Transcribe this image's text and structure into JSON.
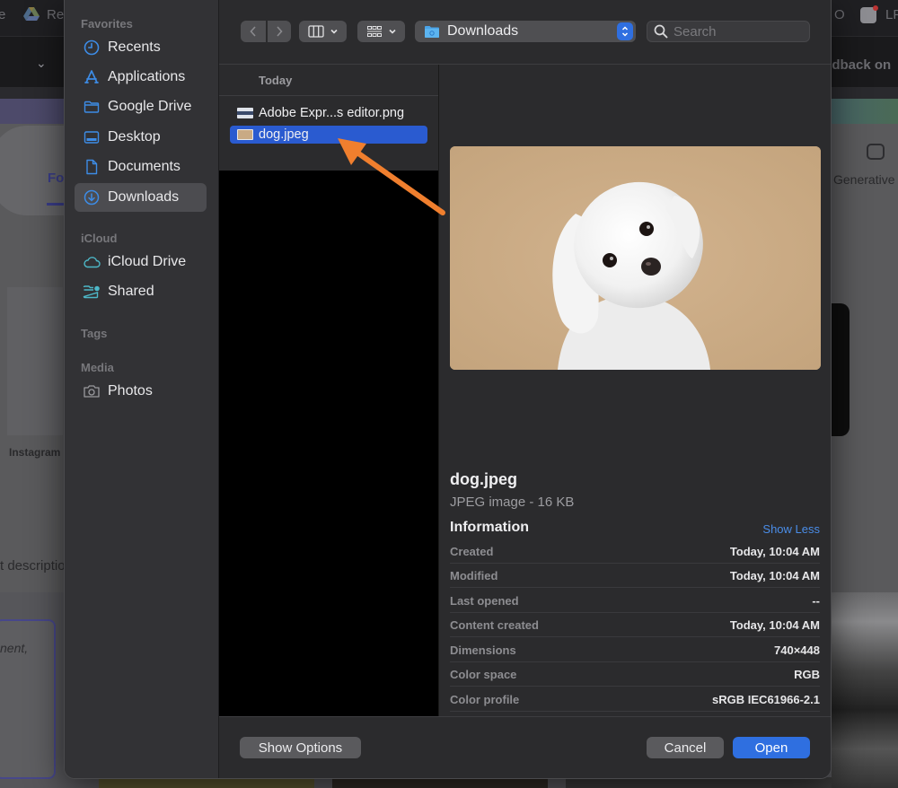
{
  "background_app": {
    "tabs": [
      "e",
      "Re",
      "O",
      "LF"
    ],
    "toolbar_text": "edback on",
    "tab_label_partial": "Fo",
    "template_label": "Instagram",
    "prompt_label_partial": "t description",
    "prompt_placeholder_partial": "nent,",
    "feature_label": "Generative"
  },
  "dialog": {
    "sidebar": {
      "sections": [
        {
          "title": "Favorites",
          "items": [
            {
              "label": "Recents",
              "icon": "clock-icon"
            },
            {
              "label": "Applications",
              "icon": "applications-icon"
            },
            {
              "label": "Google Drive",
              "icon": "folder-icon"
            },
            {
              "label": "Desktop",
              "icon": "desktop-icon"
            },
            {
              "label": "Documents",
              "icon": "document-icon"
            },
            {
              "label": "Downloads",
              "icon": "download-icon",
              "active": true
            }
          ]
        },
        {
          "title": "iCloud",
          "items": [
            {
              "label": "iCloud Drive",
              "icon": "cloud-icon"
            },
            {
              "label": "Shared",
              "icon": "shared-folder-icon"
            }
          ]
        },
        {
          "title": "Tags",
          "items": []
        },
        {
          "title": "Media",
          "items": [
            {
              "label": "Photos",
              "icon": "camera-icon"
            }
          ]
        }
      ]
    },
    "toolbar": {
      "back_icon": "chevron-left-icon",
      "forward_icon": "chevron-right-icon",
      "view_mode_icon": "columns-view-icon",
      "group_icon": "grid-group-icon",
      "location": "Downloads",
      "search_placeholder": "Search",
      "search_value": ""
    },
    "file_list": {
      "group_header": "Today",
      "files": [
        {
          "name": "Adobe Expr...s editor.png",
          "selected": false
        },
        {
          "name": "dog.jpeg",
          "selected": true
        }
      ]
    },
    "preview": {
      "file_name": "dog.jpeg",
      "kind": "JPEG image - 16 KB",
      "info_title": "Information",
      "toggle_label": "Show Less",
      "metadata": [
        {
          "key": "Created",
          "value": "Today, 10:04 AM"
        },
        {
          "key": "Modified",
          "value": "Today, 10:04 AM"
        },
        {
          "key": "Last opened",
          "value": "--"
        },
        {
          "key": "Content created",
          "value": "Today, 10:04 AM"
        },
        {
          "key": "Dimensions",
          "value": "740×448"
        },
        {
          "key": "Color space",
          "value": "RGB"
        },
        {
          "key": "Color profile",
          "value": "sRGB IEC61966-2.1"
        }
      ]
    },
    "footer": {
      "show_options": "Show Options",
      "cancel": "Cancel",
      "open": "Open"
    }
  },
  "annotation": {
    "type": "arrow",
    "color": "#f07f2e",
    "points_to": "dog.jpeg"
  },
  "colors": {
    "accent": "#2f6fe0",
    "selection": "#2a5bd0",
    "link": "#4a8de8",
    "sidebar_icon": "#3d8ce6",
    "icloud_icon": "#4db8c8"
  }
}
